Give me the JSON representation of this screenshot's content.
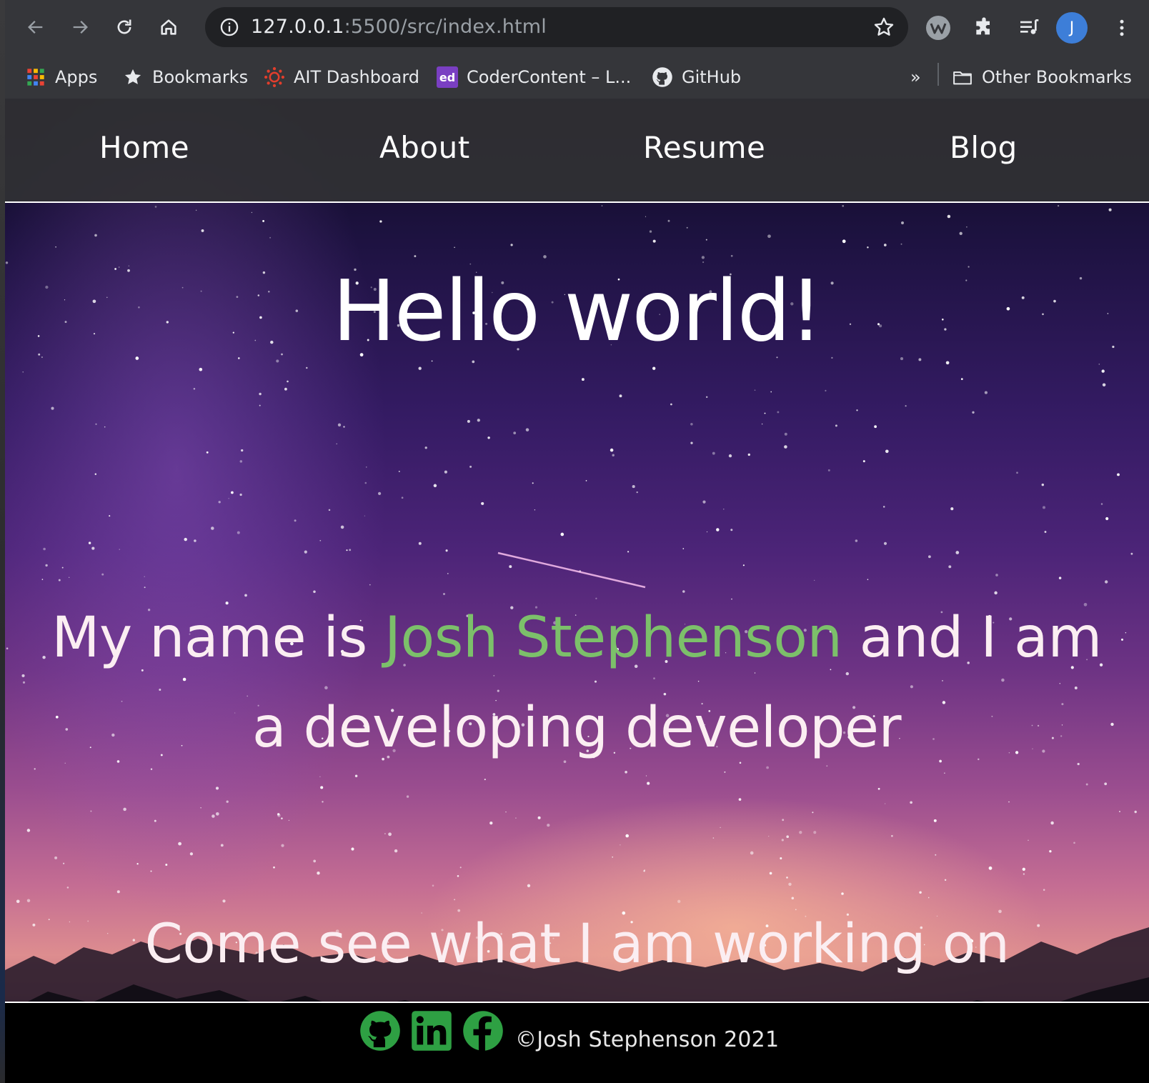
{
  "browser": {
    "url_host": "127.0.0.1",
    "url_path": ":5500/src/index.html",
    "profile_initial": "J",
    "bookmarks": [
      {
        "label": "Apps",
        "icon": "apps-grid-icon"
      },
      {
        "label": "Bookmarks",
        "icon": "star-icon"
      },
      {
        "label": "AIT Dashboard",
        "icon": "canvas-logo-icon"
      },
      {
        "label": "CoderContent – L...",
        "icon": "ed-logo-icon"
      },
      {
        "label": "GitHub",
        "icon": "github-icon"
      }
    ],
    "overflow_label": "»",
    "other_bookmarks": "Other Bookmarks"
  },
  "site": {
    "nav": [
      "Home",
      "About",
      "Resume",
      "Blog"
    ],
    "title": "Hello world!",
    "intro_prefix": "My name is ",
    "intro_name": "Josh Stephenson",
    "intro_suffix": " and I am a developing developer",
    "cta": "Come see what I am working on",
    "footer": {
      "social": [
        "github-icon",
        "linkedin-icon",
        "facebook-icon"
      ],
      "copyright": "©Josh Stephenson 2021"
    }
  },
  "colors": {
    "chrome_bg": "#35363a",
    "omnibox_bg": "#202124",
    "accent_name": "#7cc06a",
    "social_icons": "#2ea043",
    "avatar": "#3d7ed8"
  }
}
